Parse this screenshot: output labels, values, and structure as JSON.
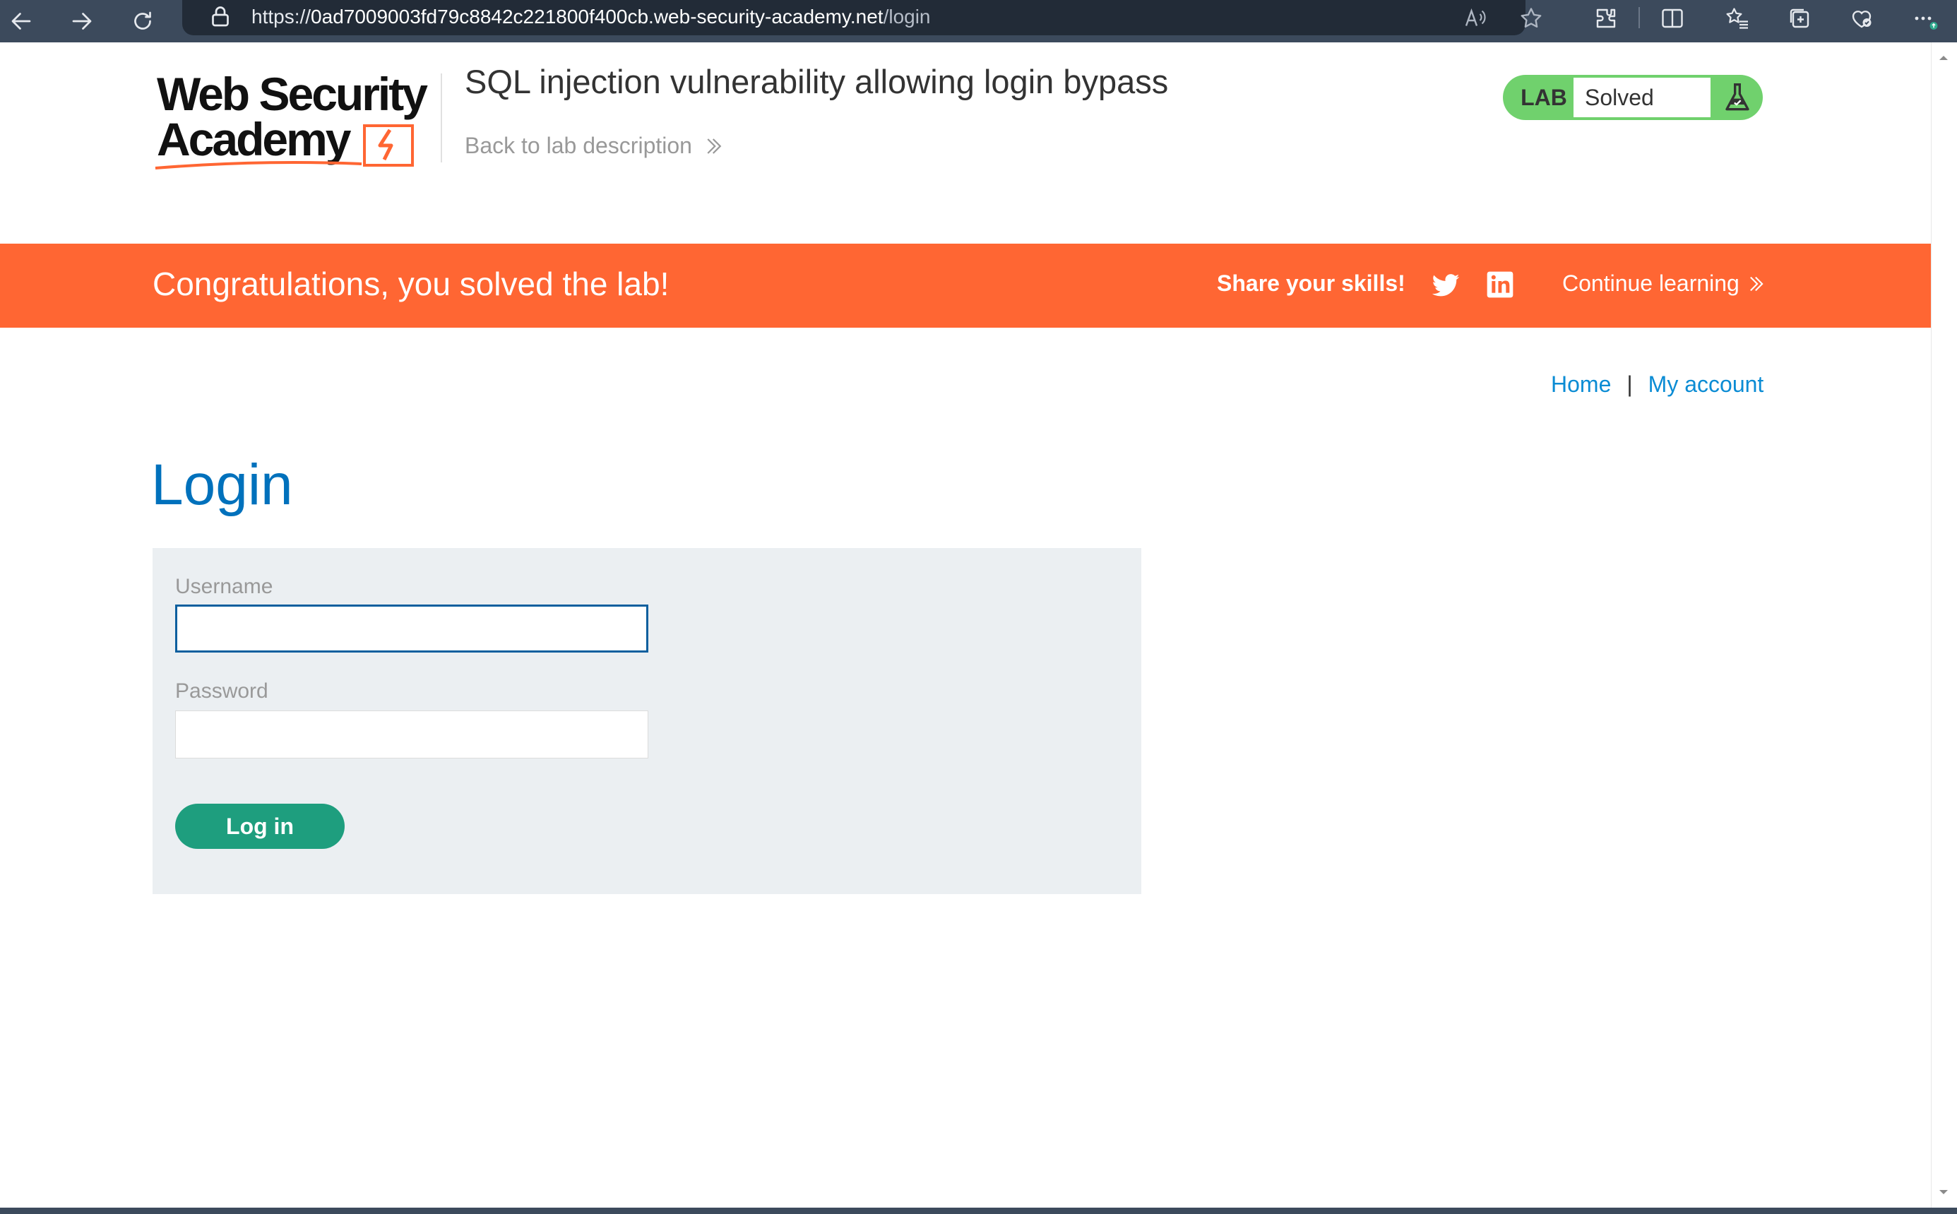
{
  "browser": {
    "url_prefix": "https://",
    "url_host": "0ad7009003fd79c8842c221800f400cb.web-security-academy.net",
    "url_path": "/login"
  },
  "header": {
    "logo": {
      "line1": "Web Security",
      "line2": "Academy"
    },
    "lab_title": "SQL injection vulnerability allowing login bypass",
    "back_link": "Back to lab description",
    "badge": {
      "label": "LAB",
      "status": "Solved"
    }
  },
  "banner": {
    "message": "Congratulations, you solved the lab!",
    "share_label": "Share your skills!",
    "continue_label": "Continue learning"
  },
  "nav": {
    "home": "Home",
    "separator": "|",
    "account": "My account"
  },
  "login": {
    "heading": "Login",
    "username_label": "Username",
    "username_value": "",
    "password_label": "Password",
    "password_value": "",
    "submit_label": "Log in"
  },
  "colors": {
    "browser_chrome": "#3c4a5c",
    "banner": "#ff6633",
    "badge_green": "#70d16d",
    "heading_blue": "#0071bc",
    "link_blue": "#0b8cd4",
    "button_teal": "#1e9e7e",
    "form_bg": "#ebeff2"
  },
  "icons": [
    "back-arrow-icon",
    "forward-arrow-icon",
    "refresh-icon",
    "lock-icon",
    "read-aloud-icon",
    "favorite-star-icon",
    "extensions-icon",
    "split-screen-icon",
    "favorites-list-icon",
    "collections-icon",
    "browser-essentials-icon",
    "more-options-icon",
    "flask-icon",
    "twitter-icon",
    "linkedin-icon",
    "chevron-double-right-icon"
  ]
}
